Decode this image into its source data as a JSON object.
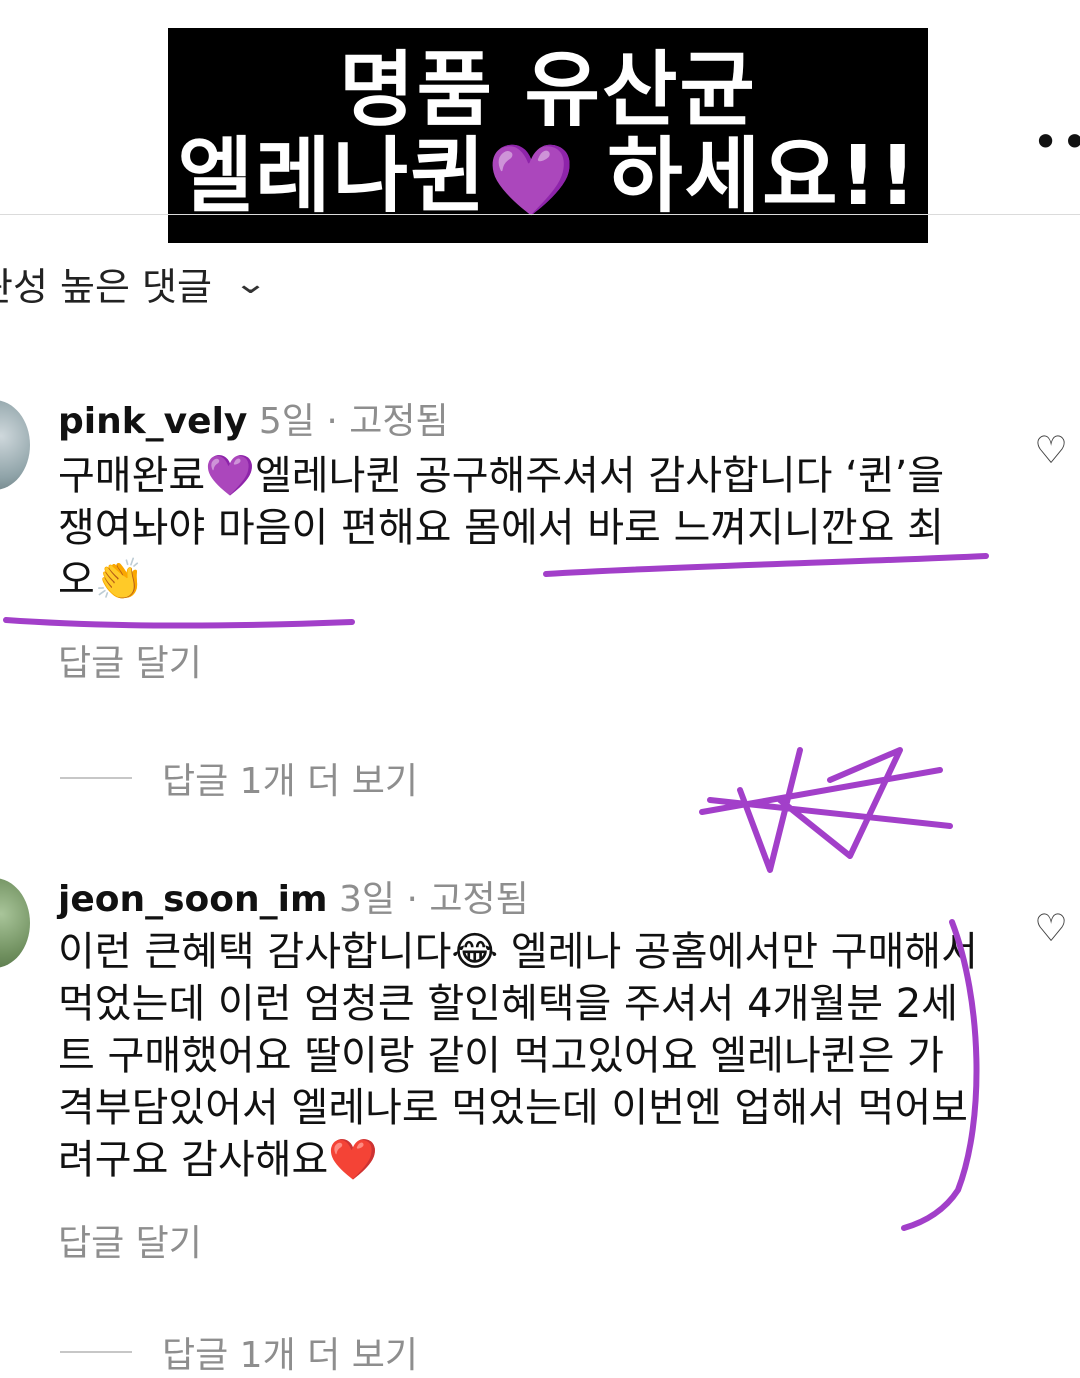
{
  "banner": {
    "line1": "명품 유산균",
    "line2": "엘레나퀸",
    "emoji": "💜",
    "line2_end": "하세요!!"
  },
  "header": {
    "more_icon": "more-horizontal-icon",
    "more_glyph": "•••"
  },
  "sort": {
    "label": "관성 높은 댓글",
    "chevron": "chevron-down-icon",
    "glyph": "⌄"
  },
  "comments": [
    {
      "username": "pink_vely",
      "time": "5일",
      "separator": "·",
      "pinned": "고정됨",
      "text": "구매완료💜엘레나퀸 공구해주셔서 감사합니다 ‘퀸’을 쟁여놔야 마음이 편해요 몸에서 바로 느껴지니깐요 최오👏",
      "reply_label": "답글 달기",
      "view_more": "답글 1개 더 보기"
    },
    {
      "username": "jeon_soon_im",
      "time": "3일",
      "separator": "·",
      "pinned": "고정됨",
      "text": "이런 큰혜택 감사합니다😂 엘레나 공홈에서만 구매해서 먹었는데 이런 엄청큰 할인혜택을 주셔서 4개월분 2세트 구매했어요 딸이랑 같이 먹고있어요 엘레나퀸은 가격부담있어서 엘레나로 먹었는데 이번엔 업해서 먹어보려구요 감사해요❤️",
      "reply_label": "답글 달기",
      "view_more": "답글 1개 더 보기"
    }
  ],
  "icons": {
    "like": "heart-outline-icon",
    "like_glyph": "♡"
  },
  "colors": {
    "annotation": "#a23fc9",
    "muted": "#8e8e8e",
    "banner_bg": "#000000"
  }
}
